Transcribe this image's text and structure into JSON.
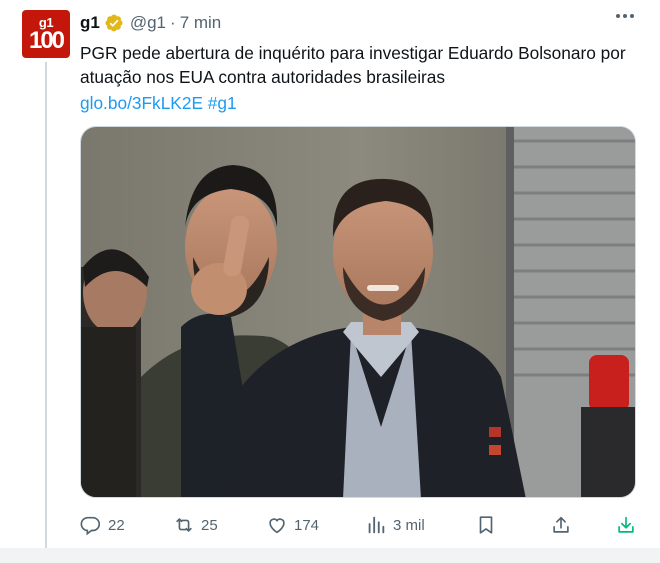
{
  "tweet": {
    "author_name": "g1",
    "handle": "@g1",
    "separator": "·",
    "time": "7 min",
    "avatar_line1": "g1",
    "avatar_line2": "100",
    "text": "PGR pede abertura de inquérito para investigar Eduardo Bolsonaro por atuação nos EUA contra autoridades brasileiras",
    "link": "glo.bo/3FkLK2E",
    "hashtag": "#g1"
  },
  "actions": {
    "replies": "22",
    "retweets": "25",
    "likes": "174",
    "views": "3 mil"
  },
  "icons": [
    "verified-badge-icon",
    "more-icon",
    "reply-icon",
    "retweet-icon",
    "like-icon",
    "views-icon",
    "bookmark-icon",
    "share-icon",
    "download-icon"
  ],
  "colors": {
    "brand": "#c4170c",
    "link": "#1d9bf0",
    "muted": "#536471",
    "verified_gold": "#e2b719",
    "download_green": "#00ba7c"
  }
}
